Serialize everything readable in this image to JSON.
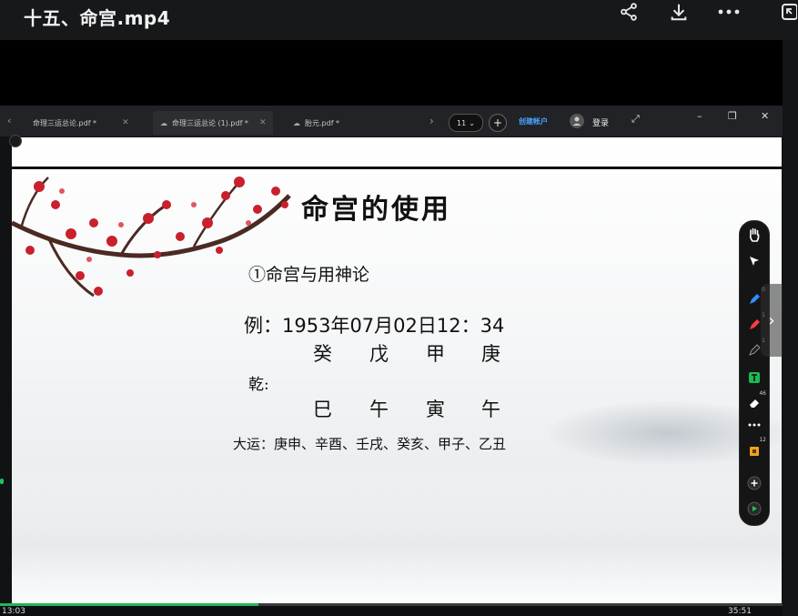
{
  "player": {
    "title": "十五、命宫.mp4",
    "time_current": "13:03",
    "time_total": "35:51",
    "progress": 0.33,
    "icons": [
      "share-icon",
      "download-icon",
      "more-icon",
      "exit-fullscreen-icon"
    ]
  },
  "pdf_app": {
    "tabs": [
      {
        "label": "命理三运总论.pdf *"
      },
      {
        "label": "命理三运总论 (1).pdf *"
      },
      {
        "label": "胎元.pdf *"
      }
    ],
    "tab_count": "11",
    "create_account": "创建帐户",
    "login": "登录",
    "accent": "#4aa3ff"
  },
  "slide": {
    "title": "命宫的使用",
    "subtitle": "①命宫与用神论",
    "example": "例：1953年07月02日12：34",
    "stems": [
      "癸",
      "戊",
      "甲",
      "庚"
    ],
    "qian": "乾:",
    "branches": [
      "巳",
      "午",
      "寅",
      "午"
    ],
    "dayun": "大运：庚申、辛酉、壬戌、癸亥、甲子、乙丑"
  },
  "toolbar": {
    "badges": [
      "0",
      "1",
      "1",
      "46",
      "12"
    ]
  }
}
